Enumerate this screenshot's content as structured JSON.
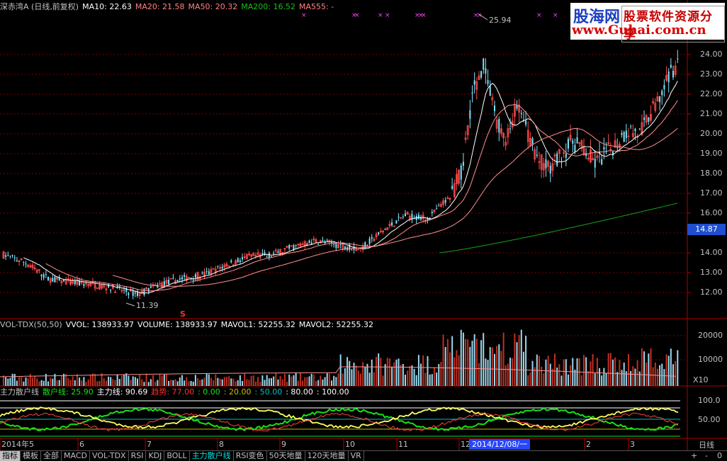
{
  "legend_main": [
    {
      "text": "深赤湾A (日线,前复权)",
      "color": "#c0c0c0"
    },
    {
      "text": "MA10: 22.63",
      "color": "#ffffff"
    },
    {
      "text": "MA20: 21.58",
      "color": "#ff8080"
    },
    {
      "text": "MA50: 20.32",
      "color": "#ff8080"
    },
    {
      "text": "MA200: 16.52",
      "color": "#18c018"
    },
    {
      "text": "MA555: -",
      "color": "#ff8080"
    }
  ],
  "legend_vol": [
    {
      "text": "VOL-TDX(50,50)",
      "color": "#c0c0c0"
    },
    {
      "text": "VVOL: 138933.97",
      "color": "#ffffff"
    },
    {
      "text": "VOLUME: 138933.97",
      "color": "#ffffff"
    },
    {
      "text": "MAVOL1: 52255.32",
      "color": "#ffffff"
    },
    {
      "text": "MAVOL2: 52255.32",
      "color": "#ffffff"
    }
  ],
  "legend_ind": [
    {
      "text": "主力散户线",
      "color": "#c0c0c0"
    },
    {
      "text": "散户线: 25.90",
      "color": "#18e018"
    },
    {
      "text": "主力线: 90.69",
      "color": "#ffffff"
    },
    {
      "text": "趋势: 77.00",
      "color": "#ff3030"
    },
    {
      "text": ": 0.00",
      "color": "#18e018"
    },
    {
      "text": ": 20.00",
      "color": "#c0c000"
    },
    {
      "text": ": 50.00",
      "color": "#00c0c0"
    },
    {
      "text": ": 80.00",
      "color": "#ffffff"
    },
    {
      "text": ": 100.00",
      "color": "#ffffff"
    }
  ],
  "price_axis": [
    "24.00",
    "23.00",
    "22.00",
    "21.00",
    "20.00",
    "19.00",
    "18.00",
    "17.00",
    "16.00",
    "15.00",
    "14.00",
    "13.00",
    "12.00"
  ],
  "current_price": "14.87",
  "vol_axis": [
    "20000",
    "10000"
  ],
  "vol_unit": "X10",
  "ind_axis": [
    "100.0",
    "50.00"
  ],
  "annotations": {
    "high": "25.94",
    "low": "11.39",
    "signal": "S"
  },
  "date_axis": {
    "labels": [
      "2014年5",
      "6",
      "7",
      "8",
      "9",
      "10",
      "11",
      "12",
      "2",
      "3"
    ],
    "highlight": "2014/12/08/一",
    "period": "日线"
  },
  "tabs": [
    {
      "label": "指标",
      "active": true
    },
    {
      "label": "模板"
    },
    {
      "label": "全部"
    },
    {
      "label": "MACD"
    },
    {
      "label": "VOL-TDX"
    },
    {
      "label": "RSI"
    },
    {
      "label": "KDJ"
    },
    {
      "label": "BOLL"
    },
    {
      "label": "主力散户线",
      "cyan": true
    },
    {
      "label": "RSI变色"
    },
    {
      "label": "50天地量"
    },
    {
      "label": "120天地量"
    },
    {
      "label": "VR"
    }
  ],
  "zoom_controls": [
    "+",
    "-",
    "0"
  ],
  "watermark": {
    "brand": "股海网",
    "slogan": "股票软件资源分享",
    "url": "www.Guhai.com.cn"
  },
  "colors": {
    "up": "#ff4a4a",
    "down": "#7fe4ff",
    "ma200": "#18a018",
    "ma20": "#ff8080"
  },
  "chart_data": {
    "type": "candlestick",
    "ylim": [
      11.0,
      26.0
    ],
    "price_path": [
      [
        0,
        13.9
      ],
      [
        10,
        13.5
      ],
      [
        20,
        12.7
      ],
      [
        30,
        12.5
      ],
      [
        40,
        12.4
      ],
      [
        50,
        12.2
      ],
      [
        60,
        11.9
      ],
      [
        70,
        12.4
      ],
      [
        80,
        12.7
      ],
      [
        90,
        12.9
      ],
      [
        100,
        13.4
      ],
      [
        110,
        13.8
      ],
      [
        120,
        13.9
      ],
      [
        130,
        14.3
      ],
      [
        140,
        14.6
      ],
      [
        150,
        14.4
      ],
      [
        160,
        14.2
      ],
      [
        170,
        15.1
      ],
      [
        180,
        15.9
      ],
      [
        190,
        15.7
      ],
      [
        200,
        16.8
      ],
      [
        205,
        18.0
      ],
      [
        210,
        22.0
      ],
      [
        215,
        23.5
      ],
      [
        220,
        21.0
      ],
      [
        225,
        19.5
      ],
      [
        230,
        21.5
      ],
      [
        235,
        20.0
      ],
      [
        240,
        18.6
      ],
      [
        245,
        18.2
      ],
      [
        250,
        19.0
      ],
      [
        255,
        19.6
      ],
      [
        260,
        19.2
      ],
      [
        265,
        18.5
      ],
      [
        270,
        19.0
      ],
      [
        275,
        19.6
      ],
      [
        280,
        20.2
      ],
      [
        285,
        20.0
      ],
      [
        290,
        21.0
      ],
      [
        295,
        22.0
      ],
      [
        300,
        23.3
      ],
      [
        302,
        23.5
      ]
    ]
  }
}
